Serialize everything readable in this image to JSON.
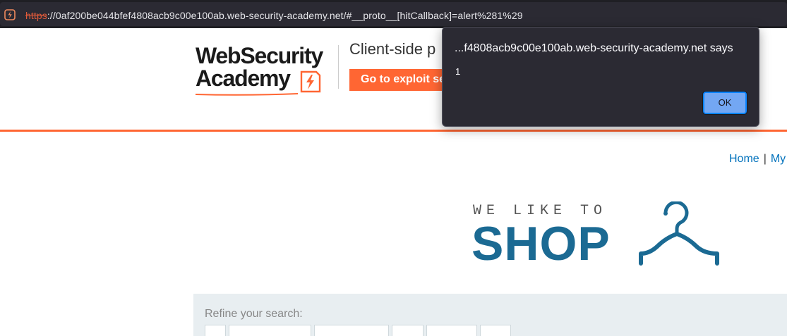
{
  "browser": {
    "url_scheme": "https",
    "url_rest": "://0af200be044bfef4808acb9c00e100ab.web-security-academy.net/#__proto__[hitCallback]=alert%281%29",
    "site_icon": "burp-lightning-icon"
  },
  "header": {
    "logo_line1": "WebSecurity",
    "logo_line2": "Academy",
    "lab_title": "Client-side p",
    "exploit_button": "Go to exploit se"
  },
  "nav": {
    "home": "Home",
    "separator": "|",
    "my_account": "My"
  },
  "banner": {
    "tagline": "WE LIKE TO",
    "shop": "SHOP",
    "icon": "hanger-icon"
  },
  "search": {
    "refine_label": "Refine your search:"
  },
  "alert": {
    "origin": "...f4808acb9c00e100ab.web-security-academy.net says",
    "message": "1",
    "ok_label": "OK"
  },
  "colors": {
    "brand_orange": "#ff6633",
    "shop_blue": "#1b6a93",
    "link_blue": "#0071bc",
    "dialog_bg": "#2b2a33",
    "ok_button": "#73a7f3"
  }
}
